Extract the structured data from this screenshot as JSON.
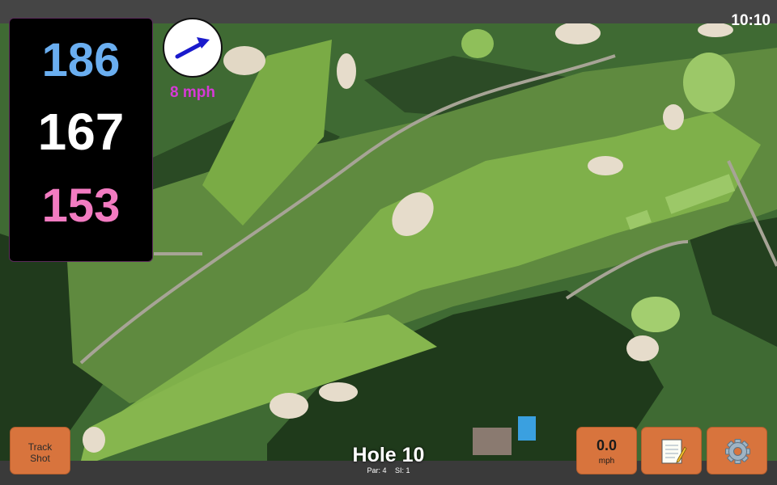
{
  "status": {
    "time": "10:10"
  },
  "distances": {
    "back": "186",
    "center": "167",
    "front": "153"
  },
  "wind": {
    "speed_label": "8 mph"
  },
  "buttons": {
    "track_shot_line1": "Track",
    "track_shot_line2": "Shot",
    "speed_value": "0.0",
    "speed_unit": "mph"
  },
  "hole": {
    "title": "Hole 10",
    "par": "Par: 4",
    "si": "SI: 1"
  },
  "icons": {
    "wind": "wind-direction-arrow-icon",
    "notes": "notepad-icon",
    "settings": "gear-icon"
  },
  "colors": {
    "back_distance": "#6aaef0",
    "center_distance": "#ffffff",
    "front_distance": "#f27bc1",
    "wind_arrow": "#1a1acc",
    "wind_speed_text": "#d63ad6",
    "button": "#d8743d"
  }
}
